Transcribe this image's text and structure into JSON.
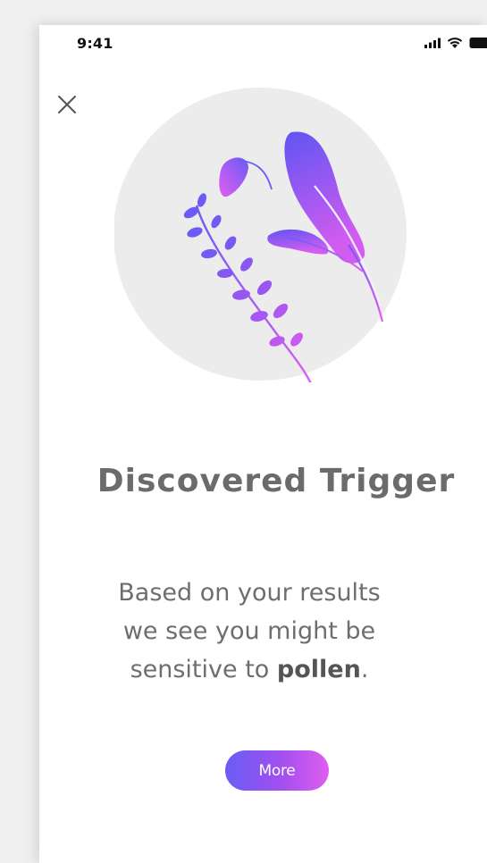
{
  "status_bar": {
    "time": "9:41",
    "icons": [
      "signal-icon",
      "wifi-icon",
      "battery-icon"
    ]
  },
  "header": {
    "close_icon": "close-icon"
  },
  "illustration": {
    "icon": "pollen-plants-illustration",
    "colors": {
      "circle": "#ececec",
      "gradient_start": "#6a5cf5",
      "gradient_end": "#e05ef0"
    }
  },
  "content": {
    "title": "Discovered Trigger",
    "body_line1": "Based on your results",
    "body_line2": "we see you might be",
    "body_line3_prefix": "sensitive to ",
    "body_highlight": "pollen",
    "body_suffix": "."
  },
  "actions": {
    "more_label": "More"
  },
  "colors": {
    "accent_gradient_start": "#6a5cf5",
    "accent_gradient_end": "#e05ef0",
    "title_text": "#6b6b6b",
    "body_text": "#6e6e6e"
  }
}
